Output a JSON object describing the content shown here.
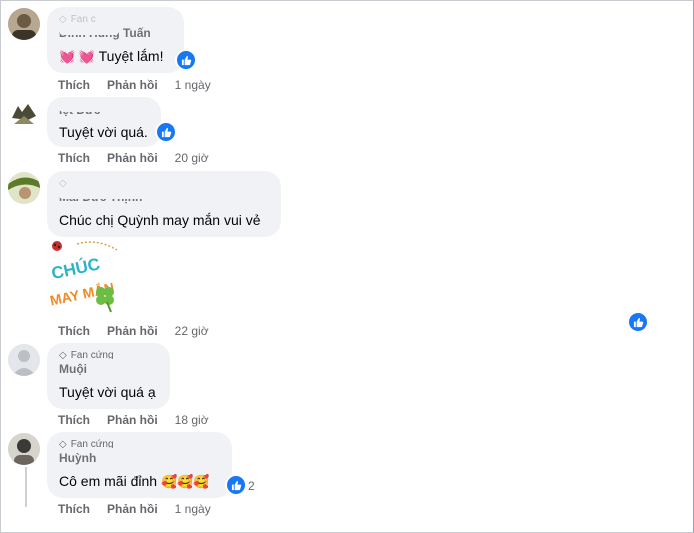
{
  "comments": [
    {
      "badge": "Fan c",
      "author": "Đinh Hùng Tuấn",
      "text": "Tuyệt lắm!",
      "emoji_prefix": "💓 💓",
      "actions": {
        "like": "Thích",
        "reply": "Phản hồi",
        "time": "1 ngày"
      }
    },
    {
      "author": "Iệt Đức",
      "text": "Tuyệt vời quá.",
      "actions": {
        "like": "Thích",
        "reply": "Phản hồi",
        "time": "20 giờ"
      }
    },
    {
      "badge": "",
      "author": "Mai Đức Thịnh",
      "text": "Chúc chị Quỳnh may mắn vui vẻ",
      "sticker_text": [
        "CHÚC",
        "MAY MẮN"
      ],
      "actions": {
        "like": "Thích",
        "reply": "Phản hồi",
        "time": "22 giờ"
      }
    },
    {
      "badge": "Fan cứng",
      "author": "Muội",
      "text": "Tuyệt vời quá ạ",
      "actions": {
        "like": "Thích",
        "reply": "Phản hồi",
        "time": "18 giờ"
      }
    },
    {
      "badge": "Fan cứng",
      "author": "Huỳnh",
      "text": "Cô em mãi đỉnh",
      "emoji_suffix": "🥰🥰🥰",
      "reaction_count": "2",
      "actions": {
        "like": "Thích",
        "reply": "Phản hồi",
        "time": "1 ngày"
      }
    }
  ],
  "colors": {
    "like_blue": "#1877f2",
    "bubble": "#f0f2f5",
    "meta": "#65676b"
  },
  "icons": {
    "reaction": "like-icon",
    "badge": "diamond-icon"
  }
}
